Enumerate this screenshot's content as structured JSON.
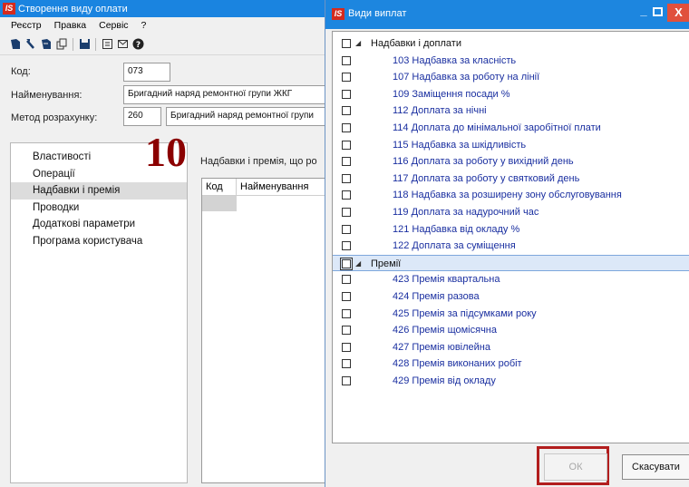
{
  "main_window": {
    "app_logo": "IS",
    "title": "Створення виду оплати",
    "menu": [
      "Реєстр",
      "Правка",
      "Сервіс",
      "?"
    ],
    "toolbar_icons": [
      "new-icon",
      "edit-icon",
      "copy-icon",
      "copy-window-icon",
      "save-icon",
      "form-icon",
      "mail-icon",
      "help-icon"
    ],
    "fields": {
      "code_label": "Код:",
      "code_value": "073",
      "name_label": "Найменування:",
      "name_value": "Бригадний наряд ремонтної групи ЖКГ",
      "method_label": "Метод розрахунку:",
      "method_code": "260",
      "method_name": "Бригадний наряд ремонтної групи"
    },
    "nav": [
      "Властивості",
      "Операції",
      "Надбавки і премія",
      "Проводки",
      "Додаткові параметри",
      "Програма користувача"
    ],
    "nav_selected_index": 2,
    "annotation_number": "10",
    "section_caption": "Надбавки і премія, що ро",
    "grid_columns": [
      "Код",
      "Найменування"
    ]
  },
  "dialog": {
    "app_logo": "IS",
    "title": "Види виплат",
    "controls": {
      "minimize": "_",
      "close": "X"
    },
    "groups": [
      {
        "label": "Надбавки і доплати",
        "items": [
          "103 Надбавка за класність",
          "107 Надбавка за роботу на лінії",
          "109 Заміщення посади %",
          "112 Доплата за нічні",
          "114 Доплата до мінімальної заробітної плати",
          "115 Надбавка за шкідливість",
          "116 Доплата за роботу у вихідний день",
          "117 Доплата за роботу у святковий день",
          "118 Надбавка за розширену зону обслуговування",
          "119 Доплата за надурочний час",
          "121 Надбавка від окладу %",
          "122 Доплата за суміщення"
        ]
      },
      {
        "label": "Премії",
        "items": [
          "423 Премія квартальна",
          "424 Премія разова",
          "425 Премія за підсумками року",
          "426 Премія щомісячна",
          "427 Премія ювілейна",
          "428 Премія виконаних робіт",
          "429 Премія від окладу"
        ]
      }
    ],
    "selected_group": "Премії",
    "buttons": {
      "ok": "ОК",
      "cancel": "Скасувати"
    },
    "colors": {
      "titlebar": "#1d86df",
      "item_text": "#1a2fa0",
      "highlight": "#b21e1e",
      "close": "#e0503c"
    }
  }
}
